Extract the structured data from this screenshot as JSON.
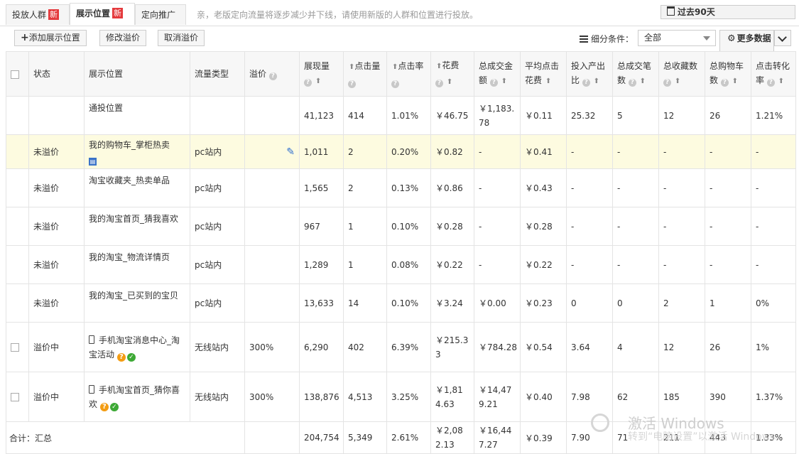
{
  "tabs": [
    {
      "label": "投放人群",
      "badge": "新"
    },
    {
      "label": "展示位置",
      "badge": "新"
    },
    {
      "label": "定向推广"
    }
  ],
  "notice": "亲，老版定向流量将逐步减少并下线，请使用新版的人群和位置进行投放。",
  "date_range": "过去90天",
  "toolbar": {
    "add_label": "添加展示位置",
    "modify_label": "修改溢价",
    "cancel_label": "取消溢价",
    "filter_label": "细分条件：",
    "filter_value": "全部",
    "more_label": "更多数据"
  },
  "columns": [
    "状态",
    "展示位置",
    "流量类型",
    "溢价",
    "展现量",
    "点击量",
    "点击率",
    "花费",
    "总成交金额",
    "平均点击花费",
    "投入产出比",
    "总成交笔数",
    "总收藏数",
    "总购物车数",
    "点击转化率"
  ],
  "rows": [
    {
      "status": "",
      "place": "通投位置",
      "type": "",
      "premium": "",
      "imp": "41,123",
      "clk": "414",
      "ctr": "1.01%",
      "cost": "￥46.75",
      "gmv": "￥1,183.78",
      "cpc": "￥0.11",
      "roi": "25.32",
      "orders": "5",
      "fav": "12",
      "cart": "26",
      "cvr": "1.21%"
    },
    {
      "status": "未溢价",
      "place": "我的购物车_掌柜热卖",
      "type": "pc站内",
      "premium": "",
      "imp": "1,011",
      "clk": "2",
      "ctr": "0.20%",
      "cost": "￥0.82",
      "gmv": "-",
      "cpc": "￥0.41",
      "roi": "-",
      "orders": "-",
      "fav": "-",
      "cart": "-",
      "cvr": "-"
    },
    {
      "status": "未溢价",
      "place": "淘宝收藏夹_热卖单品",
      "type": "pc站内",
      "premium": "",
      "imp": "1,565",
      "clk": "2",
      "ctr": "0.13%",
      "cost": "￥0.86",
      "gmv": "-",
      "cpc": "￥0.43",
      "roi": "-",
      "orders": "-",
      "fav": "-",
      "cart": "-",
      "cvr": "-"
    },
    {
      "status": "未溢价",
      "place": "我的淘宝首页_猜我喜欢",
      "type": "pc站内",
      "premium": "",
      "imp": "967",
      "clk": "1",
      "ctr": "0.10%",
      "cost": "￥0.28",
      "gmv": "-",
      "cpc": "￥0.28",
      "roi": "-",
      "orders": "-",
      "fav": "-",
      "cart": "-",
      "cvr": "-"
    },
    {
      "status": "未溢价",
      "place": "我的淘宝_物流详情页",
      "type": "pc站内",
      "premium": "",
      "imp": "1,289",
      "clk": "1",
      "ctr": "0.08%",
      "cost": "￥0.22",
      "gmv": "-",
      "cpc": "￥0.22",
      "roi": "-",
      "orders": "-",
      "fav": "-",
      "cart": "-",
      "cvr": "-"
    },
    {
      "status": "未溢价",
      "place": "我的淘宝_已买到的宝贝",
      "type": "pc站内",
      "premium": "",
      "imp": "13,633",
      "clk": "14",
      "ctr": "0.10%",
      "cost": "￥3.24",
      "gmv": "￥0.00",
      "cpc": "￥0.23",
      "roi": "0",
      "orders": "0",
      "fav": "2",
      "cart": "1",
      "cvr": "0%"
    },
    {
      "status": "溢价中",
      "place": "手机淘宝消息中心_淘宝活动",
      "type": "无线站内",
      "premium": "300%",
      "imp": "6,290",
      "clk": "402",
      "ctr": "6.39%",
      "cost": "￥215.33",
      "gmv": "￥784.28",
      "cpc": "￥0.54",
      "roi": "3.64",
      "orders": "4",
      "fav": "12",
      "cart": "26",
      "cvr": "1%"
    },
    {
      "status": "溢价中",
      "place": "手机淘宝首页_猜你喜欢",
      "type": "无线站内",
      "premium": "300%",
      "imp": "138,876",
      "clk": "4,513",
      "ctr": "3.25%",
      "cost": "￥1,814.63",
      "gmv": "￥14,479.21",
      "cpc": "￥0.40",
      "roi": "7.98",
      "orders": "62",
      "fav": "185",
      "cart": "390",
      "cvr": "1.37%"
    }
  ],
  "summary": {
    "label": "合计：汇总",
    "imp": "204,754",
    "clk": "5,349",
    "ctr": "2.61%",
    "cost": "￥2,082.13",
    "gmv": "￥16,447.27",
    "cpc": "￥0.39",
    "roi": "7.90",
    "orders": "71",
    "fav": "211",
    "cart": "443",
    "cvr": "1.33%"
  },
  "watermark": {
    "line1": "激活 Windows",
    "line2": "转到“电脑设置”以激活 Windows。"
  },
  "colors": {
    "accent_orange": "#f47a12",
    "green": "#3d9c2a",
    "badge_red": "#e4393c",
    "highlight_row": "#fdfbe0"
  }
}
